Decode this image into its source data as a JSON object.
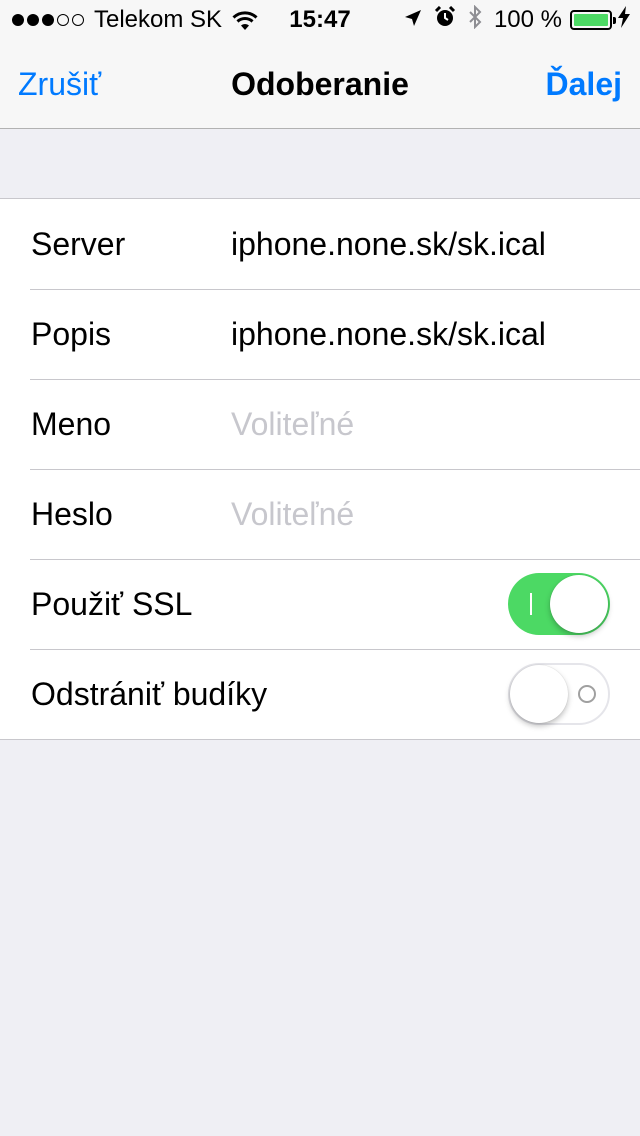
{
  "status_bar": {
    "signal_full": 3,
    "signal_empty": 2,
    "carrier": "Telekom SK",
    "time": "15:47",
    "battery_percent": "100 %",
    "icons": [
      "wifi-icon",
      "location-arrow-icon",
      "alarm-clock-icon",
      "bluetooth-icon",
      "battery-icon",
      "charging-bolt-icon"
    ],
    "battery_color": "#4cd964"
  },
  "nav": {
    "cancel_label": "Zrušiť",
    "title": "Odoberanie",
    "next_label": "Ďalej",
    "accent_color": "#007aff"
  },
  "form": {
    "server": {
      "label": "Server",
      "value": "iphone.none.sk/sk.ical"
    },
    "description": {
      "label": "Popis",
      "value": "iphone.none.sk/sk.ical"
    },
    "username": {
      "label": "Meno",
      "value": "",
      "placeholder": "Voliteľné"
    },
    "password": {
      "label": "Heslo",
      "value": "",
      "placeholder": "Voliteľné"
    },
    "use_ssl": {
      "label": "Použiť SSL",
      "on": true
    },
    "remove_alarms": {
      "label": "Odstrániť budíky",
      "on": false
    }
  },
  "toggle_on_color": "#4cd964"
}
